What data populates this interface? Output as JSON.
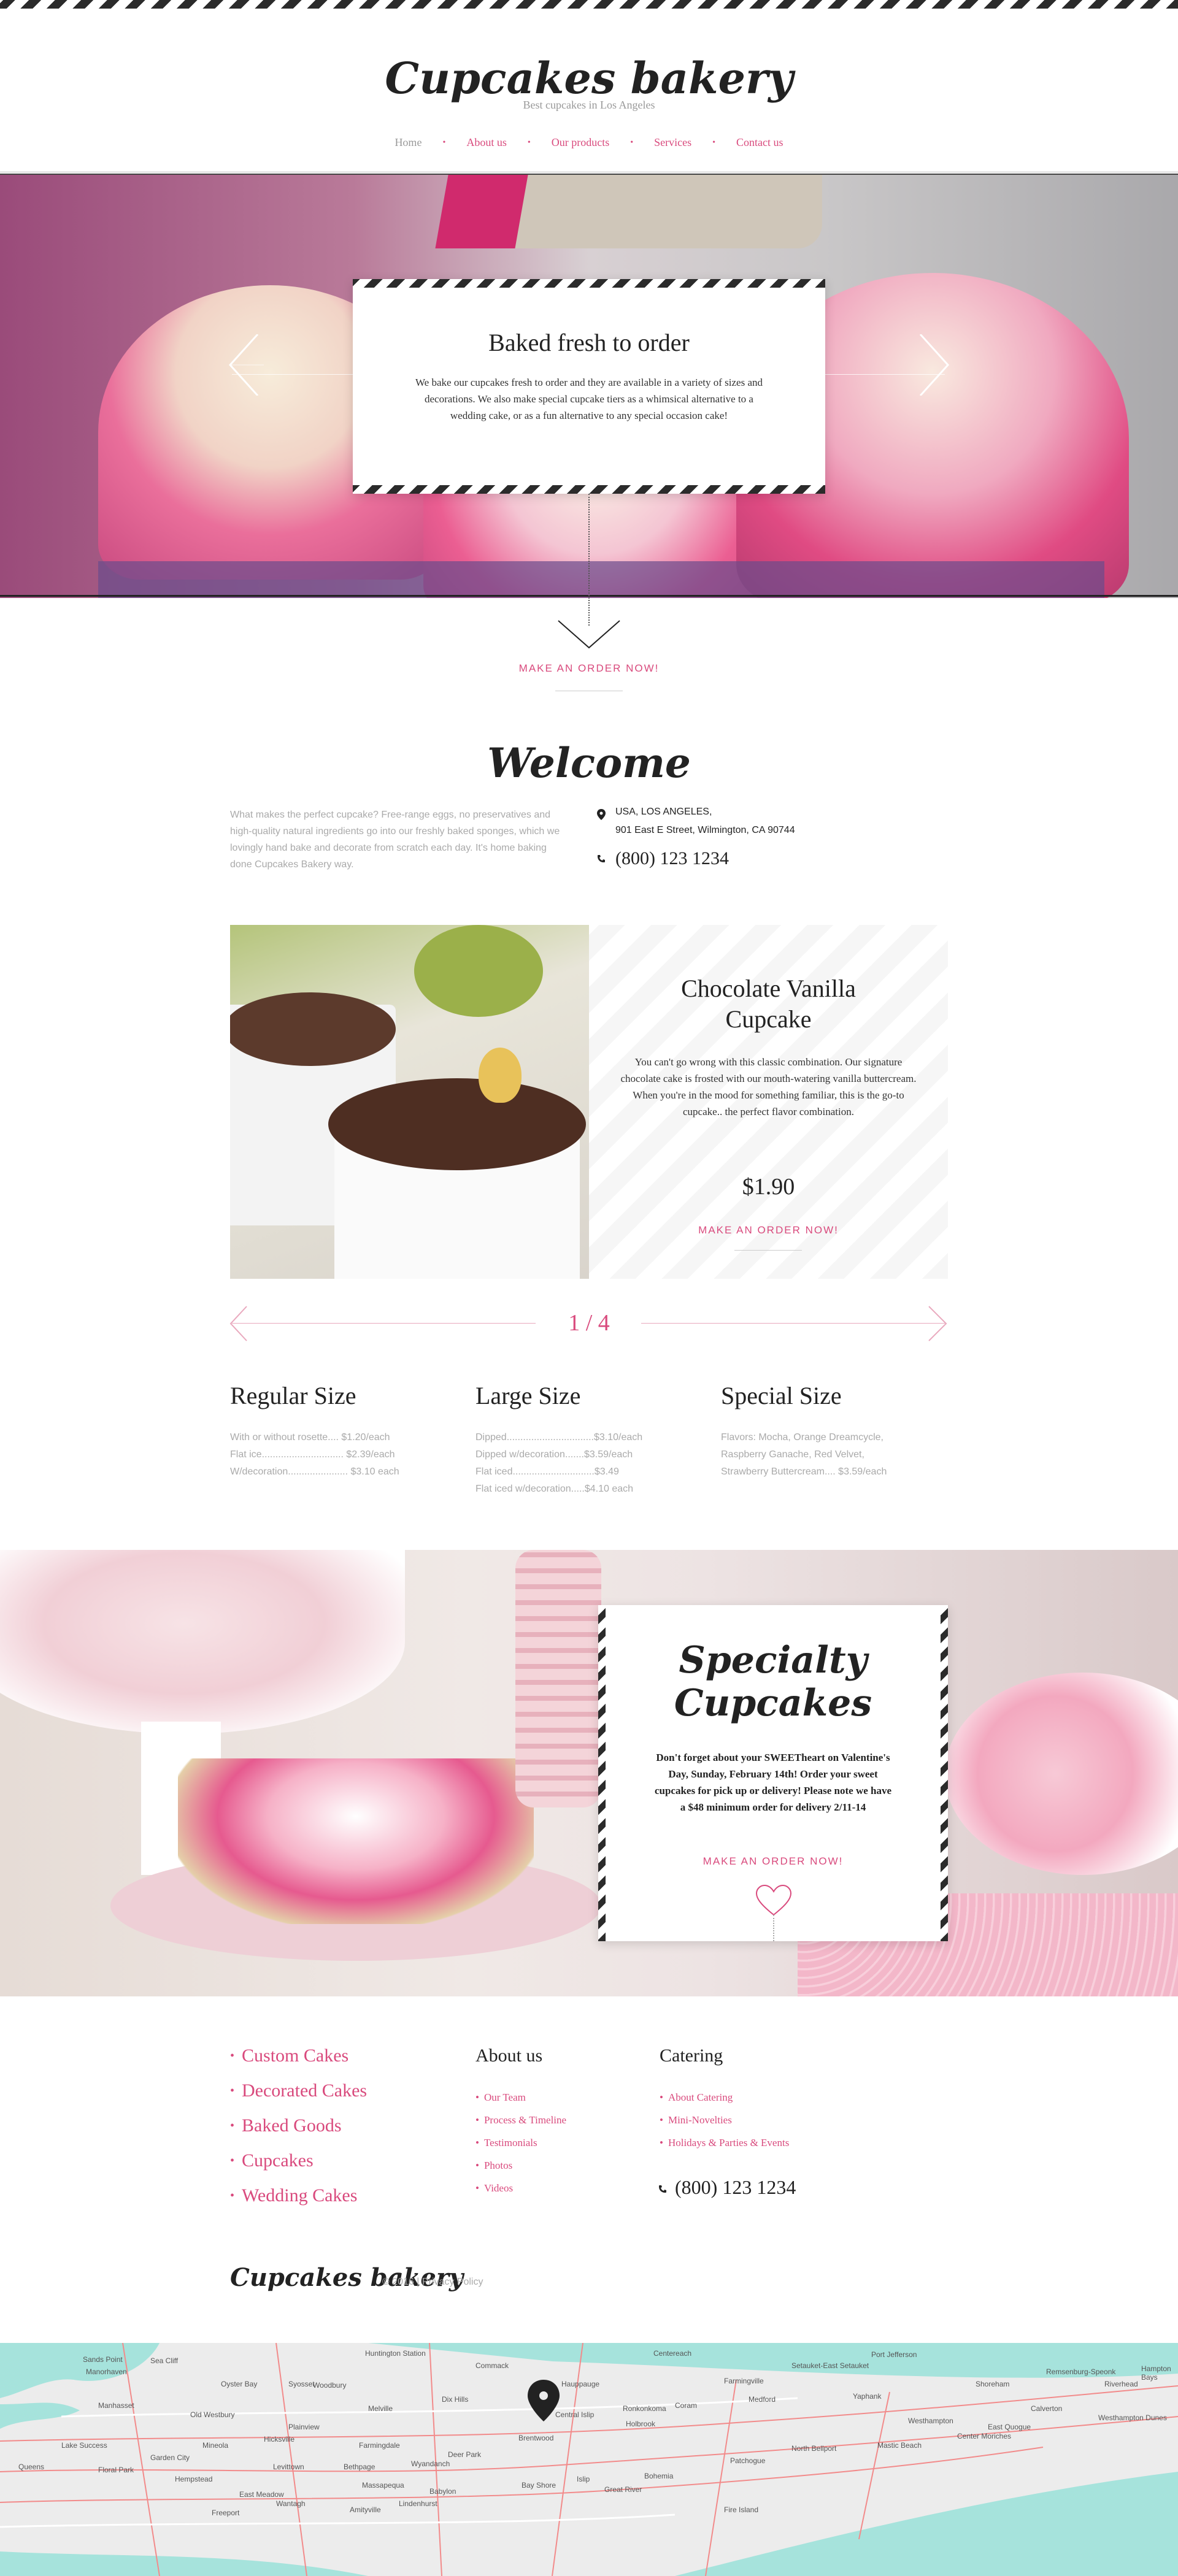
{
  "brand": {
    "name": "Cupcakes bakery",
    "tagline": "Best cupcakes in Los Angeles"
  },
  "nav": {
    "items": [
      "Home",
      "About us",
      "Our products",
      "Services",
      "Contact us"
    ]
  },
  "hero": {
    "title": "Baked fresh to order",
    "text": "We bake our cupcakes fresh to order and they are available in a variety of sizes and decorations. We also make special cupcake tiers as a whimsical alternative to a wedding cake, or as a fun alternative to any special occasion cake!",
    "cta": "MAKE AN ORDER NOW!"
  },
  "welcome": {
    "title": "Welcome",
    "text": "What makes the perfect cupcake? Free-range eggs, no preservatives and high-quality natural ingredients go into our freshly baked sponges, which we lovingly hand bake and decorate from scratch each day. It's home baking done Cupcakes Bakery way.",
    "address_line1": "USA, LOS ANGELES,",
    "address_line2": "901 East E Street, Wilmington, CA 90744",
    "phone": "(800) 123 1234"
  },
  "product": {
    "title_line1": "Chocolate Vanilla",
    "title_line2": "Cupcake",
    "text": "You can't go wrong with this classic combination. Our signature chocolate cake is frosted with our mouth-watering vanilla buttercream. When you're in the mood for something familiar, this is the go-to cupcake.. the perfect flavor combination.",
    "price": "$1.90",
    "cta": "MAKE AN ORDER NOW!",
    "pager": "1 / 4"
  },
  "sizes": {
    "regular": {
      "title": "Regular Size",
      "rows": [
        "With or without rosette.... $1.20/each",
        "Flat ice.............................. $2.39/each",
        "W/decoration...................... $3.10 each"
      ]
    },
    "large": {
      "title": "Large Size",
      "rows": [
        "Dipped................................$3.10/each",
        "Dipped w/decoration.......$3.59/each",
        "Flat iced..............................$3.49",
        "Flat iced w/decoration.....$4.10 each"
      ]
    },
    "special": {
      "title": "Special Size",
      "rows": [
        "Flavors: Mocha, Orange Dreamcycle,",
        "Raspberry Ganache, Red Velvet,",
        "Strawberry Buttercream.... $3.59/each"
      ]
    }
  },
  "specialty": {
    "title_line1": "Specialty",
    "title_line2": "Cupcakes",
    "text": "Don't forget about your SWEETheart on Valentine's Day, Sunday, February 14th! Order your sweet cupcakes for pick up or delivery! Please note we have a $48 minimum order for delivery 2/11-14",
    "cta": "MAKE AN ORDER NOW!"
  },
  "footer": {
    "products": [
      "Custom Cakes",
      "Decorated Cakes",
      "Baked Goods",
      "Cupcakes",
      "Wedding Cakes"
    ],
    "about_title": "About us",
    "about_links": [
      "Our Team",
      "Process & Timeline",
      "Testimonials",
      "Photos",
      "Videos"
    ],
    "catering_title": "Catering",
    "catering_links": [
      "About Catering",
      "Mini-Novelties",
      "Holidays & Parties & Events"
    ],
    "phone": "(800) 123 1234",
    "copyright": "© 2016 |",
    "privacy": "Privacy Policy"
  },
  "map": {
    "labels": [
      "Sands Point",
      "Manorhaven",
      "Sea Cliff",
      "Huntington Station",
      "Commack",
      "Hauppauge",
      "Centereach",
      "Farmingville",
      "Setauket-East Setauket",
      "Port Jefferson",
      "Shoreham",
      "Riverhead",
      "Ronkonkoma",
      "Medford",
      "Yaphank",
      "Manhasset",
      "Syosset",
      "Woodbury",
      "Melville",
      "Dix Hills",
      "Central Islip",
      "Holbrook",
      "Coram",
      "Calverton",
      "Remsenburg-Speonk",
      "Hampton Bays",
      "Westhampton",
      "East Quogue",
      "Old Westbury",
      "Hicksville",
      "Farmingdale",
      "Wyandanch",
      "Deer Park",
      "Bay Shore",
      "Islip",
      "Bohemia",
      "Patchogue",
      "Mastic Beach",
      "Center Moriches",
      "Garden City",
      "Hempstead",
      "Levittown",
      "East Meadow",
      "Massapequa",
      "Babylon",
      "Lindenhurst",
      "Amityville",
      "Wantagh",
      "Freeport",
      "Brentwood",
      "Queens",
      "Floral Park",
      "Great River",
      "Fire Island",
      "North Bellport",
      "Westhampton Dunes",
      "Plainview",
      "Mineola",
      "Bethpage",
      "Lake Success",
      "Oyster Bay"
    ]
  },
  "colors": {
    "accent": "#d94a7d",
    "dark": "#2b2b2b",
    "sea": "#a6e3dc"
  }
}
